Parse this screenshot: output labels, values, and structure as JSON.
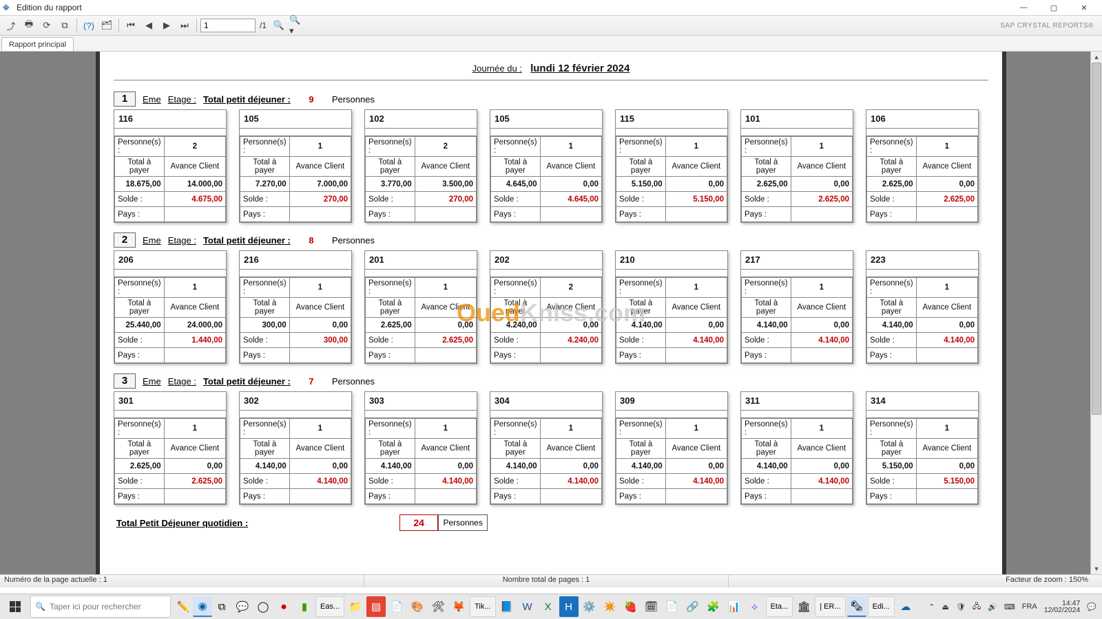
{
  "window": {
    "title": "Edition du rapport",
    "brand": "SAP CRYSTAL REPORTS®"
  },
  "toolbar": {
    "page_current": "1",
    "page_sep": "/1",
    "tab_label": "Rapport principal"
  },
  "status": {
    "left": "Numéro de la page actuelle : 1",
    "mid": "Nombre total de pages : 1",
    "right": "Facteur de zoom : 150%"
  },
  "report": {
    "date_label": "Journée du :",
    "date_value": "lundi 12 février 2024",
    "labels": {
      "eme": "Eme",
      "etage": "Etage :",
      "petit_dej": "Total petit déjeuner  :",
      "personnes_word": "Personnes",
      "persons_label": "Personne(s) :",
      "total_payer": "Total à payer",
      "avance_client": "Avance Client",
      "solde": "Solde  :",
      "pays": "Pays :",
      "total_daily": "Total Petit Déjeuner quotidien  :"
    },
    "floors": [
      {
        "num": "1",
        "count": "9",
        "rooms": [
          {
            "room": "116",
            "persons": "2",
            "total": "18.675,00",
            "avance": "14.000,00",
            "solde": "4.675,00",
            "pays": ""
          },
          {
            "room": "105",
            "persons": "1",
            "total": "7.270,00",
            "avance": "7.000,00",
            "solde": "270,00",
            "pays": ""
          },
          {
            "room": "102",
            "persons": "2",
            "total": "3.770,00",
            "avance": "3.500,00",
            "solde": "270,00",
            "pays": ""
          },
          {
            "room": "105",
            "persons": "1",
            "total": "4.645,00",
            "avance": "0,00",
            "solde": "4.645,00",
            "pays": ""
          },
          {
            "room": "115",
            "persons": "1",
            "total": "5.150,00",
            "avance": "0,00",
            "solde": "5.150,00",
            "pays": ""
          },
          {
            "room": "101",
            "persons": "1",
            "total": "2.625,00",
            "avance": "0,00",
            "solde": "2.625,00",
            "pays": ""
          },
          {
            "room": "106",
            "persons": "1",
            "total": "2.625,00",
            "avance": "0,00",
            "solde": "2.625,00",
            "pays": ""
          }
        ]
      },
      {
        "num": "2",
        "count": "8",
        "rooms": [
          {
            "room": "206",
            "persons": "1",
            "total": "25.440,00",
            "avance": "24.000,00",
            "solde": "1.440,00",
            "pays": ""
          },
          {
            "room": "216",
            "persons": "1",
            "total": "300,00",
            "avance": "0,00",
            "solde": "300,00",
            "pays": ""
          },
          {
            "room": "201",
            "persons": "1",
            "total": "2.625,00",
            "avance": "0,00",
            "solde": "2.625,00",
            "pays": ""
          },
          {
            "room": "202",
            "persons": "2",
            "total": "4.240,00",
            "avance": "0,00",
            "solde": "4.240,00",
            "pays": ""
          },
          {
            "room": "210",
            "persons": "1",
            "total": "4.140,00",
            "avance": "0,00",
            "solde": "4.140,00",
            "pays": ""
          },
          {
            "room": "217",
            "persons": "1",
            "total": "4.140,00",
            "avance": "0,00",
            "solde": "4.140,00",
            "pays": ""
          },
          {
            "room": "223",
            "persons": "1",
            "total": "4.140,00",
            "avance": "0,00",
            "solde": "4.140,00",
            "pays": ""
          }
        ]
      },
      {
        "num": "3",
        "count": "7",
        "rooms": [
          {
            "room": "301",
            "persons": "1",
            "total": "2.625,00",
            "avance": "0,00",
            "solde": "2.625,00",
            "pays": ""
          },
          {
            "room": "302",
            "persons": "1",
            "total": "4.140,00",
            "avance": "0,00",
            "solde": "4.140,00",
            "pays": ""
          },
          {
            "room": "303",
            "persons": "1",
            "total": "4.140,00",
            "avance": "0,00",
            "solde": "4.140,00",
            "pays": ""
          },
          {
            "room": "304",
            "persons": "1",
            "total": "4.140,00",
            "avance": "0,00",
            "solde": "4.140,00",
            "pays": ""
          },
          {
            "room": "309",
            "persons": "1",
            "total": "4.140,00",
            "avance": "0,00",
            "solde": "4.140,00",
            "pays": ""
          },
          {
            "room": "311",
            "persons": "1",
            "total": "4.140,00",
            "avance": "0,00",
            "solde": "4.140,00",
            "pays": ""
          },
          {
            "room": "314",
            "persons": "1",
            "total": "5.150,00",
            "avance": "0,00",
            "solde": "5.150,00",
            "pays": ""
          }
        ]
      }
    ],
    "grand_total": "24"
  },
  "taskbar": {
    "search_placeholder": "Taper ici pour rechercher",
    "lang": "FRA",
    "time": "14:47",
    "date": "12/02/2024",
    "labels": {
      "eas": "Eas...",
      "tik": "Tik...",
      "eta": "Eta...",
      "er": "| ER...",
      "edi": "Edi..."
    }
  },
  "watermark": {
    "a": "Oued",
    "b": "Kniss",
    "c": ".com"
  }
}
